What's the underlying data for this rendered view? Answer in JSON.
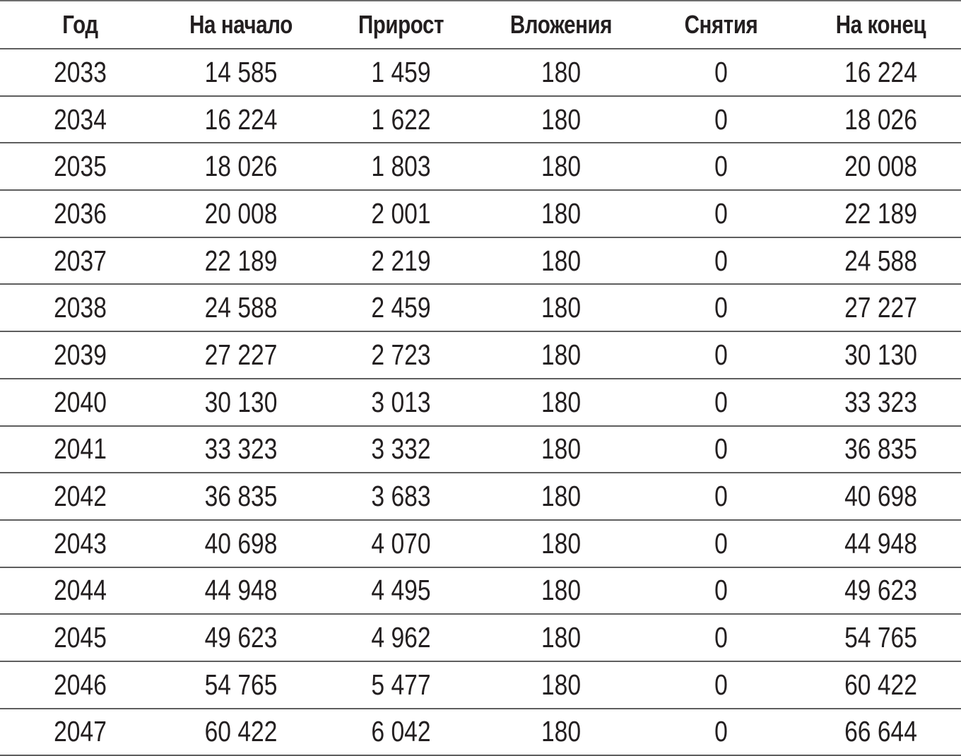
{
  "table": {
    "headers": [
      "Год",
      "На начало",
      "Прирост",
      "Вложения",
      "Снятия",
      "На конец"
    ],
    "rows": [
      [
        "2033",
        "14 585",
        "1 459",
        "180",
        "0",
        "16 224"
      ],
      [
        "2034",
        "16 224",
        "1 622",
        "180",
        "0",
        "18 026"
      ],
      [
        "2035",
        "18 026",
        "1 803",
        "180",
        "0",
        "20 008"
      ],
      [
        "2036",
        "20 008",
        "2 001",
        "180",
        "0",
        "22 189"
      ],
      [
        "2037",
        "22 189",
        "2 219",
        "180",
        "0",
        "24 588"
      ],
      [
        "2038",
        "24 588",
        "2 459",
        "180",
        "0",
        "27 227"
      ],
      [
        "2039",
        "27 227",
        "2 723",
        "180",
        "0",
        "30 130"
      ],
      [
        "2040",
        "30 130",
        "3 013",
        "180",
        "0",
        "33 323"
      ],
      [
        "2041",
        "33 323",
        "3 332",
        "180",
        "0",
        "36 835"
      ],
      [
        "2042",
        "36 835",
        "3 683",
        "180",
        "0",
        "40 698"
      ],
      [
        "2043",
        "40 698",
        "4 070",
        "180",
        "0",
        "44 948"
      ],
      [
        "2044",
        "44 948",
        "4 495",
        "180",
        "0",
        "49 623"
      ],
      [
        "2045",
        "49 623",
        "4 962",
        "180",
        "0",
        "54 765"
      ],
      [
        "2046",
        "54 765",
        "5 477",
        "180",
        "0",
        "60 422"
      ],
      [
        "2047",
        "60 422",
        "6 042",
        "180",
        "0",
        "66 644"
      ]
    ]
  },
  "colors": {
    "text": "#231f20",
    "rule": "#5e5e5e",
    "background": "#ffffff"
  }
}
